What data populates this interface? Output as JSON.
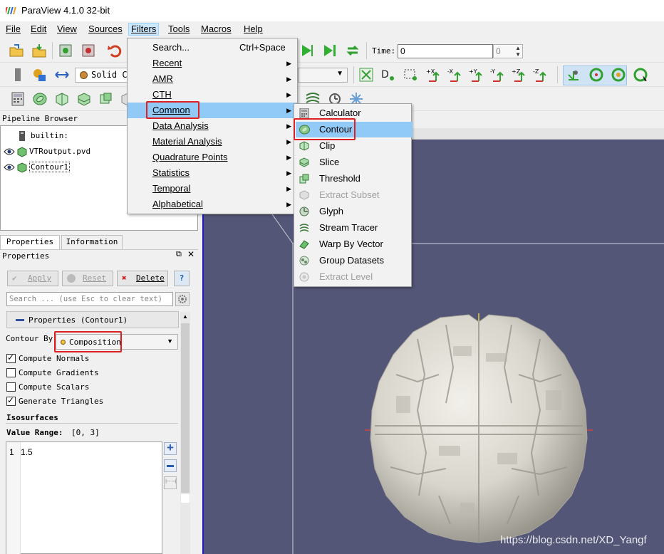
{
  "window": {
    "title": "ParaView 4.1.0 32-bit"
  },
  "menubar": {
    "items": [
      "File",
      "Edit",
      "View",
      "Sources",
      "Filters",
      "Tools",
      "Macros",
      "Help"
    ]
  },
  "time": {
    "label": "Time:",
    "value": "0",
    "step": "0"
  },
  "representation": {
    "label": "Solid Col"
  },
  "pipeline": {
    "title": "Pipeline Browser",
    "items": [
      "builtin:",
      "VTRoutput.pvd",
      "Contour1"
    ]
  },
  "tabs": [
    "Properties",
    "Information"
  ],
  "properties": {
    "title": "Properties",
    "apply": "Apply",
    "reset": "Reset",
    "delete": "Delete",
    "help": "?",
    "search_placeholder": "Search ... (use Esc to clear text)",
    "section": "Properties (Contour1)",
    "contour_by_label": "Contour By",
    "contour_by_value": "Composition",
    "checkboxes": [
      {
        "label": "Compute Normals",
        "checked": true
      },
      {
        "label": "Compute Gradients",
        "checked": false
      },
      {
        "label": "Compute Scalars",
        "checked": false
      },
      {
        "label": "Generate Triangles",
        "checked": true
      }
    ],
    "isosurfaces_label": "Isosurfaces",
    "value_range_label": "Value Range:",
    "value_range": "[0, 3]",
    "iso_index": "1",
    "iso_value": "1.5"
  },
  "filters_menu": {
    "items": [
      {
        "label": "Search...",
        "shortcut": "Ctrl+Space",
        "submenu": false
      },
      {
        "label": "Recent",
        "submenu": true
      },
      {
        "label": "AMR",
        "submenu": true
      },
      {
        "label": "CTH",
        "submenu": true
      },
      {
        "label": "Common",
        "submenu": true
      },
      {
        "label": "Data Analysis",
        "submenu": true
      },
      {
        "label": "Material Analysis",
        "submenu": true
      },
      {
        "label": "Quadrature Points",
        "submenu": true
      },
      {
        "label": "Statistics",
        "submenu": true
      },
      {
        "label": "Temporal",
        "submenu": true
      },
      {
        "label": "Alphabetical",
        "submenu": true
      }
    ]
  },
  "common_menu": {
    "items": [
      {
        "label": "Calculator",
        "enabled": true
      },
      {
        "label": "Contour",
        "enabled": true
      },
      {
        "label": "Clip",
        "enabled": true
      },
      {
        "label": "Slice",
        "enabled": true
      },
      {
        "label": "Threshold",
        "enabled": true
      },
      {
        "label": "Extract Subset",
        "enabled": false
      },
      {
        "label": "Glyph",
        "enabled": true
      },
      {
        "label": "Stream Tracer",
        "enabled": true
      },
      {
        "label": "Warp By Vector",
        "enabled": true
      },
      {
        "label": "Group Datasets",
        "enabled": true
      },
      {
        "label": "Extract Level",
        "enabled": false
      }
    ]
  },
  "watermark": "https://blog.csdn.net/XD_Yangf",
  "colors": {
    "render_bg": "#545677",
    "highlight": "#91c9f7",
    "annotation": "#e02020"
  }
}
